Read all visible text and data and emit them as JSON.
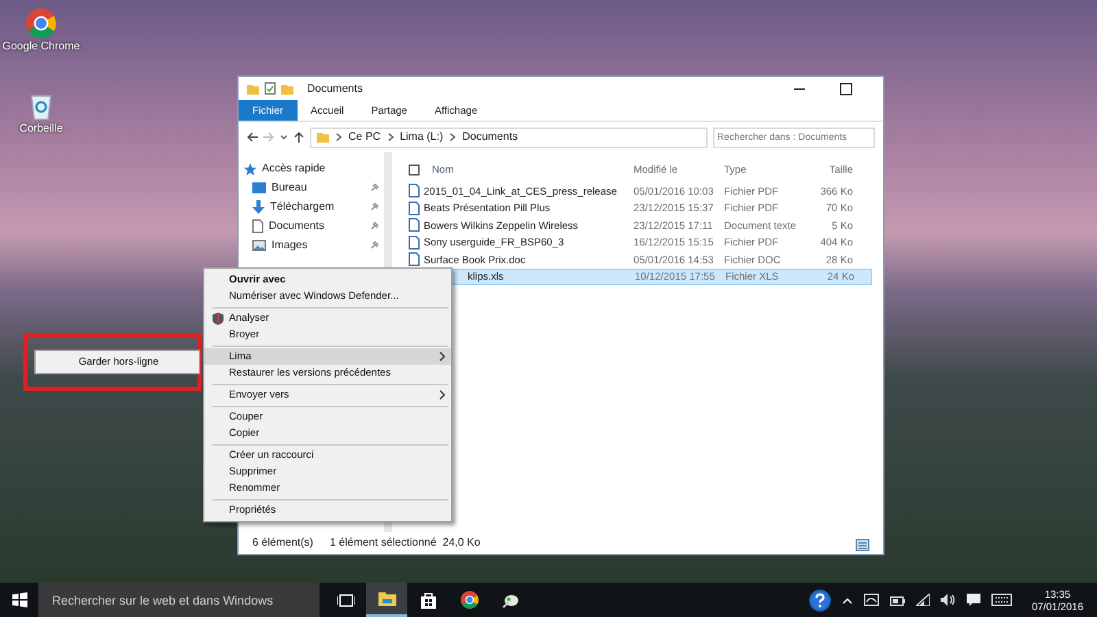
{
  "desktop_icons": [
    {
      "label": "Google Chrome",
      "kind": "chrome"
    },
    {
      "label": "Corbeille",
      "kind": "bin"
    }
  ],
  "explorer": {
    "title": "Documents",
    "ribbon_tabs": [
      {
        "label": "Fichier",
        "selected": true
      },
      {
        "label": "Accueil",
        "selected": false
      },
      {
        "label": "Partage",
        "selected": false
      },
      {
        "label": "Affichage",
        "selected": false
      }
    ],
    "address": [
      "Ce PC",
      "Lima (L:)",
      "Documents"
    ],
    "search": {
      "placeholder": "Rechercher dans : Documents"
    },
    "nav_items": [
      {
        "label": "Accès rapide",
        "kind": "star",
        "pinned": false
      },
      {
        "label": "Bureau",
        "kind": "desktop",
        "pinned": true
      },
      {
        "label": "Téléchargem",
        "kind": "download",
        "pinned": true
      },
      {
        "label": "Documents",
        "kind": "document",
        "pinned": true
      },
      {
        "label": "Images",
        "kind": "image",
        "pinned": true
      }
    ],
    "select_all_checked": false,
    "columns": [
      "Nom",
      "Modifié le",
      "Type",
      "Taille"
    ],
    "files": [
      {
        "name": "2015_01_04_Link_at_CES_press_release",
        "modified": "05/01/2016 10:03",
        "type": "Fichier PDF",
        "size": "366 Ko",
        "selected": false,
        "covered": false
      },
      {
        "name": "Beats Présentation Pill Plus",
        "modified": "23/12/2015 15:37",
        "type": "Fichier PDF",
        "size": "70 Ko",
        "selected": false,
        "covered": false
      },
      {
        "name": "Bowers Wilkins Zeppelin Wireless",
        "modified": "23/12/2015 17:11",
        "type": "Document texte",
        "size": "5 Ko",
        "selected": false,
        "covered": false
      },
      {
        "name": "Sony userguide_FR_BSP60_3",
        "modified": "16/12/2015 15:15",
        "type": "Fichier PDF",
        "size": "404 Ko",
        "selected": false,
        "covered": false
      },
      {
        "name": "Surface Book Prix.doc",
        "modified": "05/01/2016 14:53",
        "type": "Fichier DOC",
        "size": "28 Ko",
        "selected": false,
        "covered": false
      },
      {
        "name": "klips.xls",
        "modified": "10/12/2015 17:55",
        "type": "Fichier XLS",
        "size": "24 Ko",
        "selected": true,
        "covered": true
      }
    ],
    "status": {
      "count": "6 élément(s)",
      "selection": "1 élément sélectionné  24,0 Ko"
    }
  },
  "context_menu": {
    "items": [
      {
        "kind": "item",
        "label": "Ouvrir avec",
        "default": true,
        "selected": false,
        "submenu": false
      },
      {
        "kind": "item",
        "label": "Numériser avec Windows Defender...",
        "default": false,
        "selected": false,
        "submenu": false
      },
      {
        "kind": "separator"
      },
      {
        "kind": "shield-item",
        "label": "Analyser",
        "default": false,
        "selected": false,
        "submenu": false
      },
      {
        "kind": "item",
        "label": "Broyer",
        "default": false,
        "selected": false,
        "submenu": false
      },
      {
        "kind": "separator"
      },
      {
        "kind": "item",
        "label": "Lima",
        "default": false,
        "selected": true,
        "submenu": true
      },
      {
        "kind": "item",
        "label": "Restaurer les versions précédentes",
        "default": false,
        "selected": false,
        "submenu": false
      },
      {
        "kind": "separator"
      },
      {
        "kind": "item",
        "label": "Envoyer vers",
        "default": false,
        "selected": false,
        "submenu": true
      },
      {
        "kind": "separator"
      },
      {
        "kind": "item",
        "label": "Couper",
        "default": false,
        "selected": false,
        "submenu": false
      },
      {
        "kind": "item",
        "label": "Copier",
        "default": false,
        "selected": false,
        "submenu": false
      },
      {
        "kind": "separator"
      },
      {
        "kind": "item",
        "label": "Créer un raccourci",
        "default": false,
        "selected": false,
        "submenu": false
      },
      {
        "kind": "item",
        "label": "Supprimer",
        "default": false,
        "selected": false,
        "submenu": false
      },
      {
        "kind": "item",
        "label": "Renommer",
        "default": false,
        "selected": false,
        "submenu": false
      },
      {
        "kind": "separator"
      },
      {
        "kind": "item",
        "label": "Propriétés",
        "default": false,
        "selected": false,
        "submenu": false
      }
    ]
  },
  "submenu": {
    "items": [
      {
        "label": "Garder hors-ligne",
        "selected": false
      }
    ]
  },
  "taskbar": {
    "search": {
      "placeholder": "Rechercher sur le web et dans Windows"
    },
    "apps": [
      {
        "kind": "taskview",
        "active": false
      },
      {
        "kind": "explorer",
        "active": true
      },
      {
        "kind": "store",
        "active": false
      },
      {
        "kind": "chrome",
        "active": false
      },
      {
        "kind": "app",
        "active": false
      }
    ],
    "time": "13:35",
    "date": "07/01/2016"
  }
}
